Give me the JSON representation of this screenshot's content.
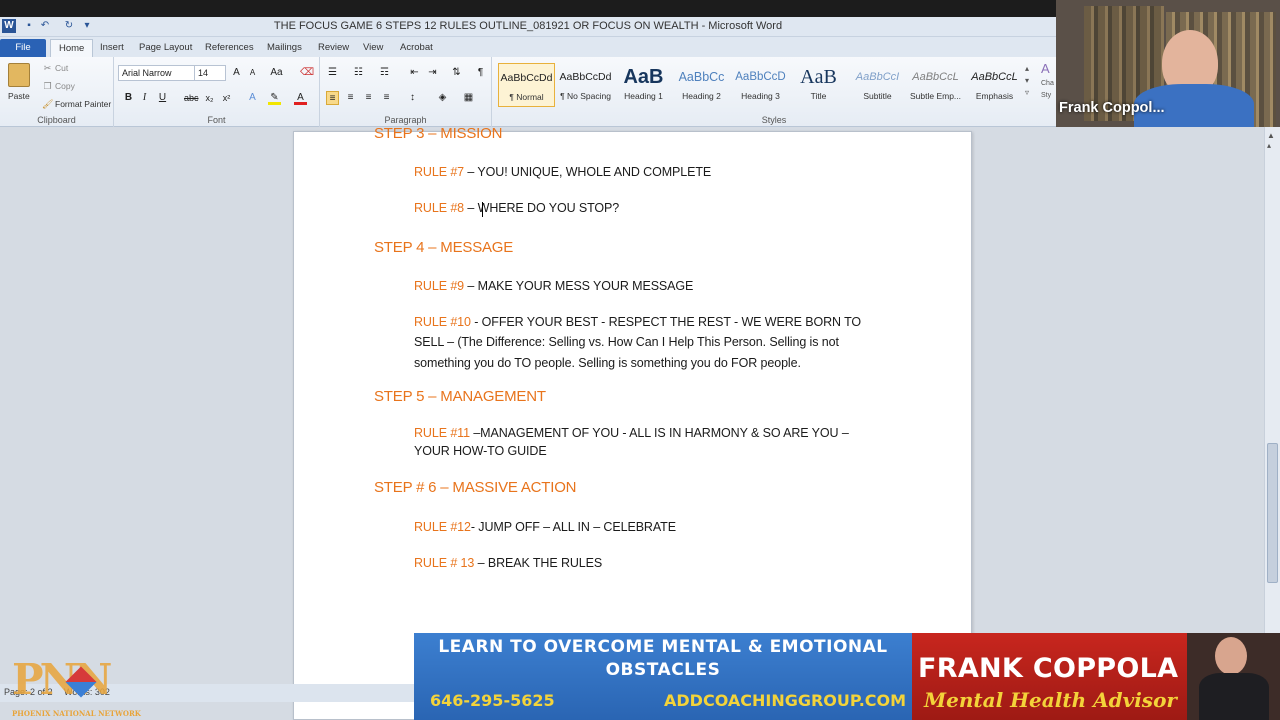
{
  "window": {
    "title": "THE FOCUS GAME 6 STEPS 12 RULES OUTLINE_081921 OR FOCUS ON WEALTH  -  Microsoft Word",
    "app_icon": "W"
  },
  "tabs": [
    "File",
    "Home",
    "Insert",
    "Page Layout",
    "References",
    "Mailings",
    "Review",
    "View",
    "Acrobat"
  ],
  "ribbon": {
    "clipboard": {
      "paste": "Paste",
      "cut": "Cut",
      "copy": "Copy",
      "format_painter": "Format Painter",
      "label": "Clipboard"
    },
    "font": {
      "name": "Arial Narrow",
      "size": "14",
      "label": "Font"
    },
    "paragraph": {
      "label": "Paragraph"
    },
    "styles": {
      "label": "Styles",
      "items": [
        {
          "sample": "AaBbCcDd",
          "name": "¶ Normal"
        },
        {
          "sample": "AaBbCcDd",
          "name": "¶ No Spacing"
        },
        {
          "sample": "AaB",
          "name": "Heading 1"
        },
        {
          "sample": "AaBbCc",
          "name": "Heading 2"
        },
        {
          "sample": "AaBbCcD",
          "name": "Heading 3"
        },
        {
          "sample": "AaB",
          "name": "Title"
        },
        {
          "sample": "AaBbCcI",
          "name": "Subtitle"
        },
        {
          "sample": "AaBbCcL",
          "name": "Subtle Emp..."
        },
        {
          "sample": "AaBbCcL",
          "name": "Emphasis"
        }
      ],
      "change_styles": "Cha Sty"
    }
  },
  "video": {
    "name": "Frank Coppol..."
  },
  "document": {
    "step3": "STEP 3 – MISSION",
    "rule7": {
      "label": "RULE #7",
      "text": " – YOU! UNIQUE, WHOLE AND COMPLETE"
    },
    "rule8": {
      "label": "RULE #8",
      "text": " –  WHERE DO YOU STOP?"
    },
    "step4": "STEP 4 – MESSAGE",
    "rule9": {
      "label": "RULE #9",
      "text": " – MAKE YOUR MESS YOUR MESSAGE"
    },
    "rule10": {
      "label": "RULE #10",
      "line1": " - OFFER YOUR BEST - RESPECT THE REST - WE WERE BORN TO",
      "line2": "SELL – (The Difference: Selling vs. How Can I Help This Person. Selling is not",
      "line3": "something you do TO people.  Selling is something you do FOR people."
    },
    "step5": "STEP 5 – MANAGEMENT",
    "rule11": {
      "label": "RULE #11",
      "line1": " –MANAGEMENT OF YOU - ALL IS IN HARMONY & SO ARE YOU –",
      "line2": "YOUR HOW-TO GUIDE"
    },
    "step6": "STEP # 6 – MASSIVE ACTION",
    "rule12": {
      "label": "RULE #12",
      "text": "- JUMP OFF – ALL IN – CELEBRATE"
    },
    "rule13": {
      "label": "RULE # 13",
      "text": " – BREAK THE RULES"
    }
  },
  "status": {
    "page": "Page: 2 of 2",
    "words": "Words: 302"
  },
  "banner": {
    "headline": "LEARN TO OVERCOME MENTAL & EMOTIONAL OBSTACLES",
    "phone": "646-295-5625",
    "url": "ADDCOACHINGGROUP.COM",
    "name": "FRANK COPPOLA",
    "role": "Mental Health Advisor"
  },
  "logo": {
    "letters": "PNN",
    "text": "PHOENIX NATIONAL NETWORK"
  }
}
